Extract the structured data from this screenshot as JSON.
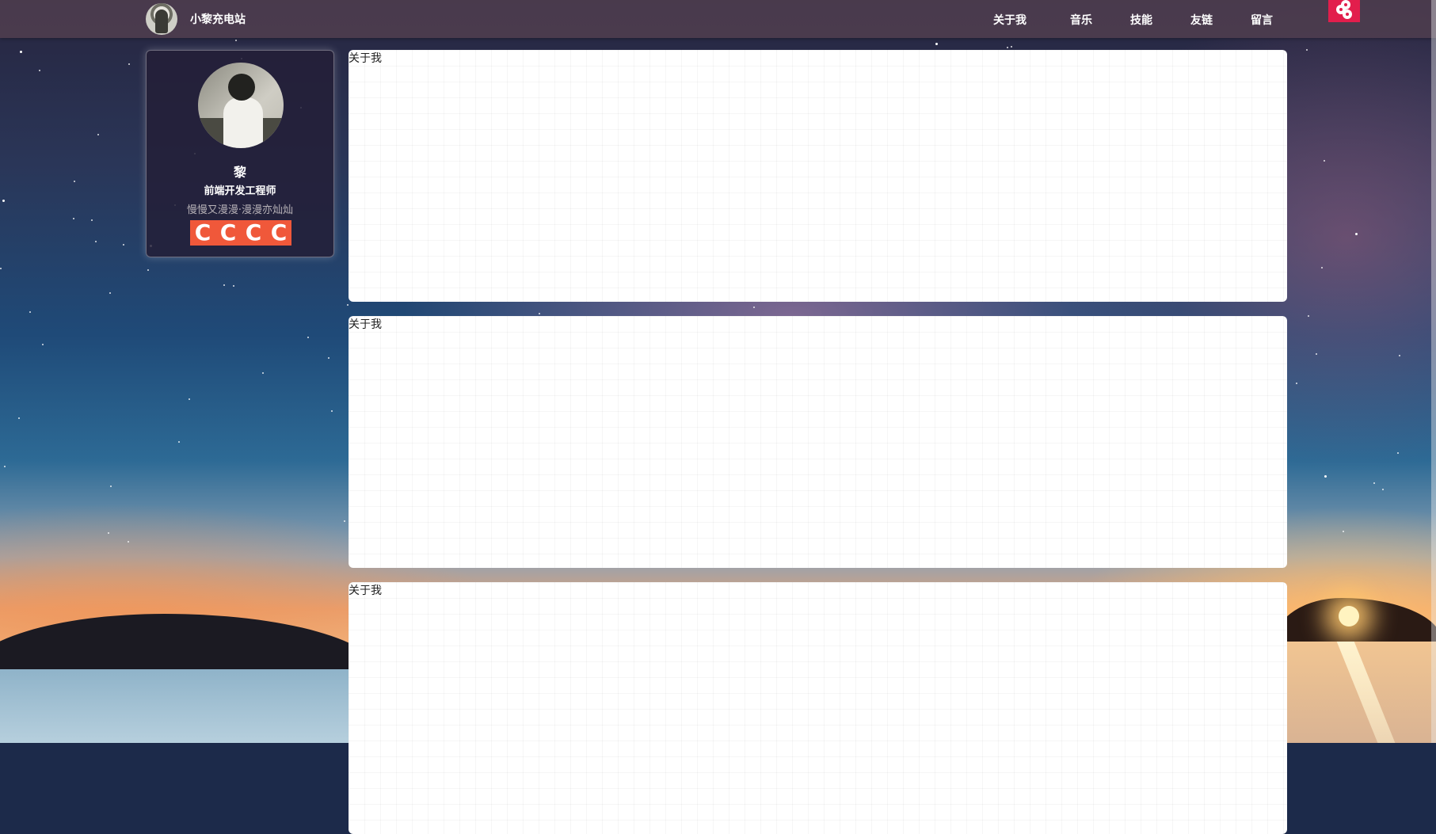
{
  "header": {
    "site_title": "小黎充电站",
    "nav": [
      {
        "label": "关于我"
      },
      {
        "label": "音乐"
      },
      {
        "label": "技能"
      },
      {
        "label": "友链"
      },
      {
        "label": "留言"
      }
    ],
    "music_button_color": "#e21e4c"
  },
  "profile": {
    "name": "黎",
    "title": "前端开发工程师",
    "motto": "慢慢又漫漫·漫漫亦灿灿",
    "social_icons": [
      "C",
      "C",
      "C",
      "C"
    ],
    "social_box_color": "#f0583a"
  },
  "panels": [
    {
      "title": "关于我"
    },
    {
      "title": "关于我"
    },
    {
      "title": "关于我"
    }
  ]
}
